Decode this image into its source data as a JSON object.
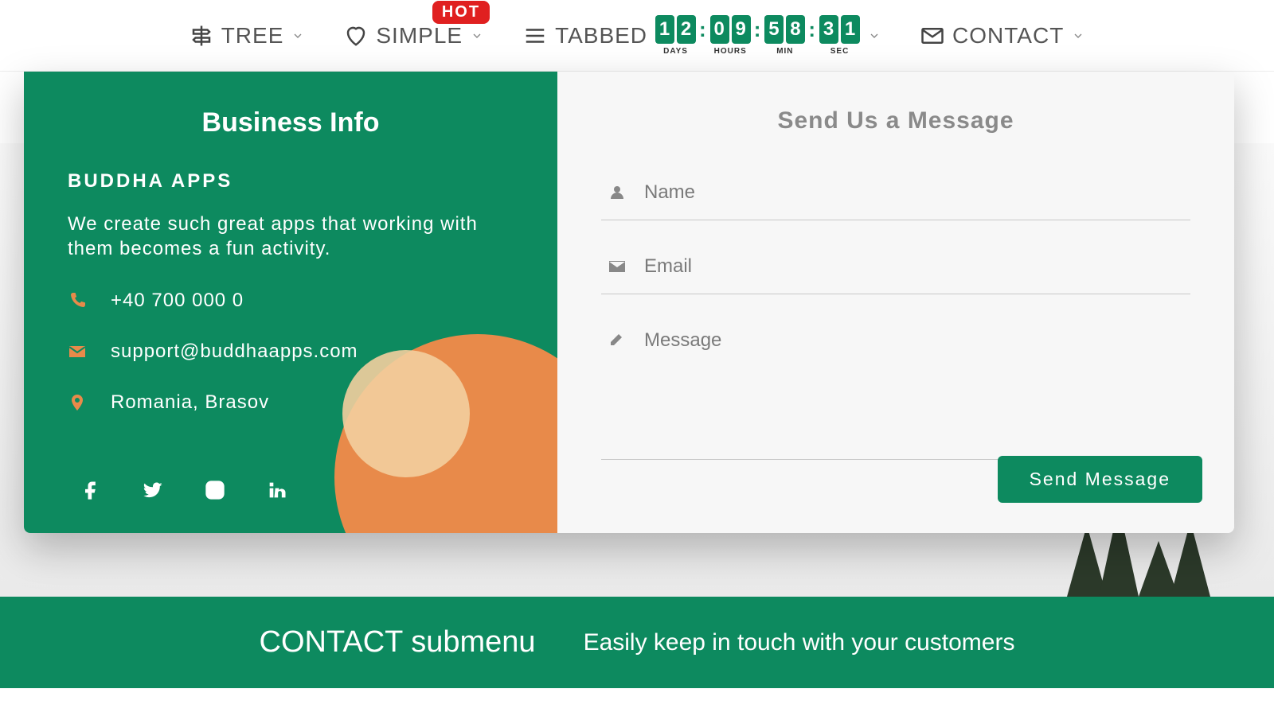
{
  "nav": {
    "tree": "TREE",
    "simple": "SIMPLE",
    "simple_badge": "HOT",
    "tabbed": "TABBED",
    "contact": "CONTACT"
  },
  "countdown": {
    "days_d0": "1",
    "days_d1": "2",
    "days_label": "DAYS",
    "hours_d0": "0",
    "hours_d1": "9",
    "hours_label": "HOURS",
    "min_d0": "5",
    "min_d1": "8",
    "min_label": "MIN",
    "sec_d0": "3",
    "sec_d1": "1",
    "sec_label": "SEC"
  },
  "info": {
    "title": "Business Info",
    "company": "BUDDHA APPS",
    "desc": "We create such great apps that working with them becomes a fun activity.",
    "phone": "+40 700 000 0",
    "email": "support@buddhaapps.com",
    "address": "Romania, Brasov"
  },
  "form": {
    "title": "Send Us a Message",
    "name_label": "Name",
    "email_label": "Email",
    "message_label": "Message",
    "send_label": "Send Message"
  },
  "banner": {
    "title": "CONTACT submenu",
    "subtitle": "Easily keep in touch with your customers"
  }
}
